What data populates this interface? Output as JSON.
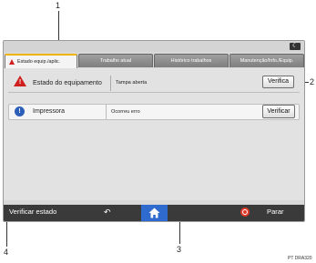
{
  "callouts": [
    "1",
    "2",
    "3",
    "4"
  ],
  "topbar": {
    "icon": "moon-icon"
  },
  "tabs": [
    {
      "label": "Estado equip./aplic.",
      "active": true
    },
    {
      "label": "Trabalho atual",
      "active": false
    },
    {
      "label": "Histórico trabalhos",
      "active": false
    },
    {
      "label": "Manutenção/Info./Equip.",
      "active": false
    }
  ],
  "equipment": {
    "label": "Estado do equipamento",
    "status": "Tampa aberta",
    "button": "Verifica"
  },
  "printer": {
    "label": "Impressora",
    "status": "Ocorreu erro",
    "button": "Verificar"
  },
  "bottom": {
    "title": "Verificar estado",
    "stop": "Parar"
  },
  "colors": {
    "warning": "#d01f1f",
    "info": "#2d5fb8",
    "home": "#2f6bcf",
    "active_tab_accent": "#f0b400",
    "stop": "#e23a2a"
  },
  "credit": "PT DRA320"
}
